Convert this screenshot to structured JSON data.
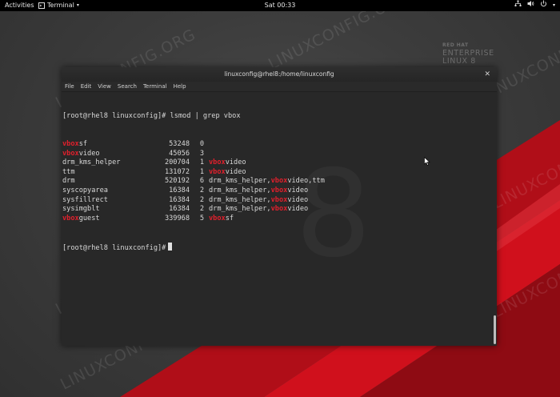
{
  "topbar": {
    "activities": "Activities",
    "app_menu": "Terminal",
    "clock": "Sat 00:33",
    "tray_icons": [
      "network-icon",
      "volume-icon",
      "power-icon",
      "chevron-down-icon"
    ]
  },
  "desktop": {
    "watermark_text": "LINUXCONFIG.ORG",
    "brand": {
      "line1": "RED HAT",
      "line2": "ENTERPRISE",
      "line3": "LINUX 8"
    },
    "background_number": "8",
    "accent_red": "#d0101c"
  },
  "window": {
    "title": "linuxconfig@rhel8:/home/linuxconfig",
    "menu": [
      "File",
      "Edit",
      "View",
      "Search",
      "Terminal",
      "Help"
    ],
    "prompt": "[root@rhel8 linuxconfig]#",
    "command": " lsmod | grep vbox",
    "rows": [
      {
        "pre": "",
        "hl": "vbox",
        "post": "sf",
        "size": "53248",
        "used": "0",
        "by": []
      },
      {
        "pre": "",
        "hl": "vbox",
        "post": "video",
        "size": "45056",
        "used": "3",
        "by": []
      },
      {
        "pre": "drm_kms_helper",
        "hl": "",
        "post": "",
        "size": "200704",
        "used": "1",
        "by": [
          {
            "t": "vbox",
            "r": true
          },
          {
            "t": "video",
            "r": false
          }
        ]
      },
      {
        "pre": "ttm",
        "hl": "",
        "post": "",
        "size": "131072",
        "used": "1",
        "by": [
          {
            "t": "vbox",
            "r": true
          },
          {
            "t": "video",
            "r": false
          }
        ]
      },
      {
        "pre": "drm",
        "hl": "",
        "post": "",
        "size": "520192",
        "used": "6",
        "by": [
          {
            "t": "drm_kms_helper,",
            "r": false
          },
          {
            "t": "vbox",
            "r": true
          },
          {
            "t": "video,ttm",
            "r": false
          }
        ]
      },
      {
        "pre": "syscopyarea",
        "hl": "",
        "post": "",
        "size": "16384",
        "used": "2",
        "by": [
          {
            "t": "drm_kms_helper,",
            "r": false
          },
          {
            "t": "vbox",
            "r": true
          },
          {
            "t": "video",
            "r": false
          }
        ]
      },
      {
        "pre": "sysfillrect",
        "hl": "",
        "post": "",
        "size": "16384",
        "used": "2",
        "by": [
          {
            "t": "drm_kms_helper,",
            "r": false
          },
          {
            "t": "vbox",
            "r": true
          },
          {
            "t": "video",
            "r": false
          }
        ]
      },
      {
        "pre": "sysimgblt",
        "hl": "",
        "post": "",
        "size": "16384",
        "used": "2",
        "by": [
          {
            "t": "drm_kms_helper,",
            "r": false
          },
          {
            "t": "vbox",
            "r": true
          },
          {
            "t": "video",
            "r": false
          }
        ]
      },
      {
        "pre": "",
        "hl": "vbox",
        "post": "guest",
        "size": "339968",
        "used": "5",
        "by": [
          {
            "t": "vbox",
            "r": true
          },
          {
            "t": "sf",
            "r": false
          }
        ]
      }
    ],
    "final_prompt": "[root@rhel8 linuxconfig]#"
  }
}
